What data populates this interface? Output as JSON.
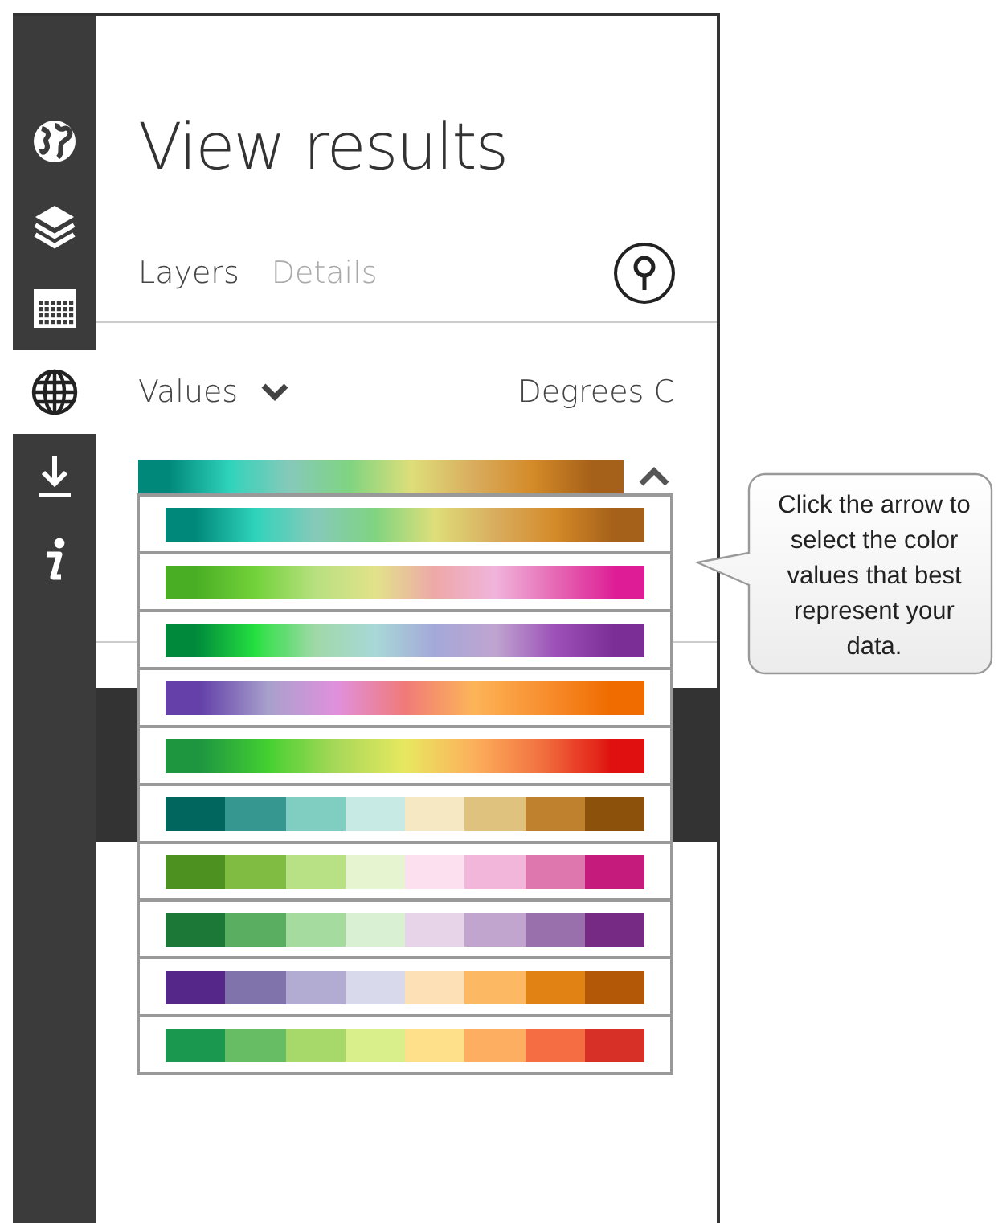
{
  "sidebar": {
    "items": [
      {
        "kind": "earth",
        "selected": false
      },
      {
        "kind": "layers",
        "selected": false
      },
      {
        "kind": "calendar",
        "selected": false
      },
      {
        "kind": "globe",
        "selected": true
      },
      {
        "kind": "download",
        "selected": false
      },
      {
        "kind": "info",
        "selected": false
      }
    ]
  },
  "title": "View results",
  "tabs": [
    {
      "label": "Layers",
      "selected": true
    },
    {
      "label": "Details",
      "selected": false
    }
  ],
  "values": {
    "label": "Values",
    "unit": "Degrees C",
    "expanded": true,
    "current": {
      "kind": "gradient",
      "stops": [
        {
          "color": "#00897b"
        },
        {
          "color": "#2ed3bb"
        },
        {
          "color": "#86c9b9"
        },
        {
          "color": "#80d480"
        },
        {
          "color": "#dede7a"
        },
        {
          "color": "#d9ad5e"
        },
        {
          "color": "#d48a28"
        },
        {
          "color": "#a5601a"
        }
      ]
    },
    "palettes": [
      {
        "kind": "gradient",
        "stops": [
          {
            "color": "#00897b"
          },
          {
            "color": "#2ed3bb"
          },
          {
            "color": "#86c9b9"
          },
          {
            "color": "#80d480"
          },
          {
            "color": "#dede7a"
          },
          {
            "color": "#d9ad5e"
          },
          {
            "color": "#d48a28"
          },
          {
            "color": "#a5601a"
          }
        ]
      },
      {
        "kind": "gradient",
        "stops": [
          {
            "color": "#4aae24"
          },
          {
            "color": "#72d23a"
          },
          {
            "color": "#b8e080"
          },
          {
            "color": "#e2e28a"
          },
          {
            "color": "#eda8a8"
          },
          {
            "color": "#f0b4dc"
          },
          {
            "color": "#e668b4"
          },
          {
            "color": "#de1c96"
          }
        ]
      },
      {
        "kind": "gradient",
        "stops": [
          {
            "color": "#00893a"
          },
          {
            "color": "#24e040"
          },
          {
            "color": "#a0d8a8"
          },
          {
            "color": "#a8d8d8"
          },
          {
            "color": "#a4a8d8"
          },
          {
            "color": "#c0a4d0"
          },
          {
            "color": "#9c50b8"
          },
          {
            "color": "#7a2e96"
          }
        ]
      },
      {
        "kind": "gradient",
        "stops": [
          {
            "color": "#6440a8"
          },
          {
            "color": "#a8a0cc"
          },
          {
            "color": "#e090dc"
          },
          {
            "color": "#f07a78"
          },
          {
            "color": "#fcb458"
          },
          {
            "color": "#f89030"
          },
          {
            "color": "#f06c00"
          }
        ]
      },
      {
        "kind": "gradient",
        "stops": [
          {
            "color": "#1e9640"
          },
          {
            "color": "#44d030"
          },
          {
            "color": "#a8d858"
          },
          {
            "color": "#e8e860"
          },
          {
            "color": "#fcb05c"
          },
          {
            "color": "#f27040"
          },
          {
            "color": "#e01010"
          }
        ]
      },
      {
        "kind": "steps",
        "stops": [
          {
            "color": "#01665e"
          },
          {
            "color": "#35978f"
          },
          {
            "color": "#80cdc1"
          },
          {
            "color": "#c7eae5"
          },
          {
            "color": "#f6e8c3"
          },
          {
            "color": "#dfc27d"
          },
          {
            "color": "#bf812d"
          },
          {
            "color": "#8c510a"
          }
        ]
      },
      {
        "kind": "steps",
        "stops": [
          {
            "color": "#4d9221"
          },
          {
            "color": "#7fbc41"
          },
          {
            "color": "#b8e186"
          },
          {
            "color": "#e6f5d0"
          },
          {
            "color": "#fde0ef"
          },
          {
            "color": "#f1b6da"
          },
          {
            "color": "#de77ae"
          },
          {
            "color": "#c51b7d"
          }
        ]
      },
      {
        "kind": "steps",
        "stops": [
          {
            "color": "#1b7837"
          },
          {
            "color": "#5aae61"
          },
          {
            "color": "#a6dba0"
          },
          {
            "color": "#d9f0d3"
          },
          {
            "color": "#e7d4e8"
          },
          {
            "color": "#c2a5cf"
          },
          {
            "color": "#9970ab"
          },
          {
            "color": "#762a83"
          }
        ]
      },
      {
        "kind": "steps",
        "stops": [
          {
            "color": "#542788"
          },
          {
            "color": "#8073ac"
          },
          {
            "color": "#b2abd2"
          },
          {
            "color": "#d8daeb"
          },
          {
            "color": "#fee0b6"
          },
          {
            "color": "#fdb863"
          },
          {
            "color": "#e08214"
          },
          {
            "color": "#b35806"
          }
        ]
      },
      {
        "kind": "steps",
        "stops": [
          {
            "color": "#1a9850"
          },
          {
            "color": "#66bd63"
          },
          {
            "color": "#a6d96a"
          },
          {
            "color": "#d9ef8b"
          },
          {
            "color": "#fee08b"
          },
          {
            "color": "#fdae61"
          },
          {
            "color": "#f46d43"
          },
          {
            "color": "#d73027"
          }
        ]
      }
    ]
  },
  "callout": {
    "text": "Click the arrow to select the color values that best represent your data."
  }
}
